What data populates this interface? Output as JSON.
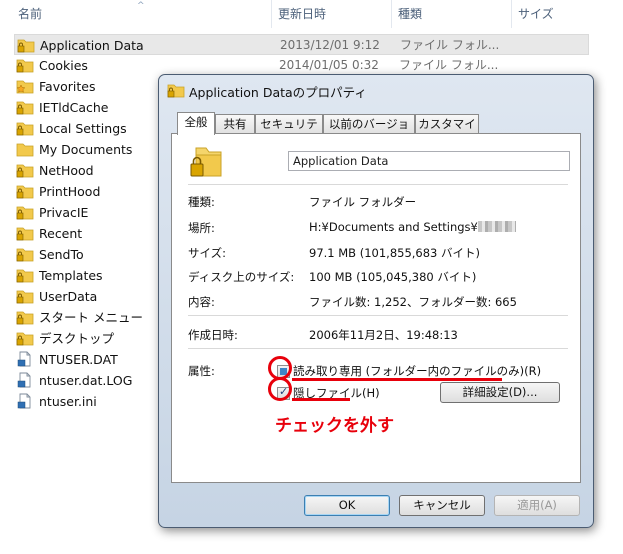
{
  "columns": {
    "name": "名前",
    "date": "更新日時",
    "type": "種類",
    "size": "サイズ"
  },
  "files": [
    {
      "name": "Application Data",
      "date": "2013/12/01 9:12",
      "type": "ファイル フォル...",
      "icon": "locked-folder-icon"
    },
    {
      "name": "Cookies",
      "date": "2014/01/05 0:32",
      "type": "ファイル フォル...",
      "icon": "locked-folder-icon"
    },
    {
      "name": "Favorites",
      "date": "",
      "type": "",
      "icon": "star-folder-icon"
    },
    {
      "name": "IETldCache",
      "date": "",
      "type": "",
      "icon": "locked-folder-icon"
    },
    {
      "name": "Local Settings",
      "date": "",
      "type": "",
      "icon": "locked-folder-icon"
    },
    {
      "name": "My Documents",
      "date": "",
      "type": "",
      "icon": "folder-icon"
    },
    {
      "name": "NetHood",
      "date": "",
      "type": "",
      "icon": "locked-folder-icon"
    },
    {
      "name": "PrintHood",
      "date": "",
      "type": "",
      "icon": "locked-folder-icon"
    },
    {
      "name": "PrivacIE",
      "date": "",
      "type": "",
      "icon": "locked-folder-icon"
    },
    {
      "name": "Recent",
      "date": "",
      "type": "",
      "icon": "locked-folder-icon"
    },
    {
      "name": "SendTo",
      "date": "",
      "type": "",
      "icon": "locked-folder-icon"
    },
    {
      "name": "Templates",
      "date": "",
      "type": "",
      "icon": "locked-folder-icon"
    },
    {
      "name": "UserData",
      "date": "",
      "type": "",
      "icon": "locked-folder-icon"
    },
    {
      "name": "スタート メニュー",
      "date": "",
      "type": "",
      "icon": "locked-folder-icon"
    },
    {
      "name": "デスクトップ",
      "date": "",
      "type": "",
      "icon": "locked-folder-icon"
    },
    {
      "name": "NTUSER.DAT",
      "date": "",
      "type": "",
      "icon": "file-icon"
    },
    {
      "name": "ntuser.dat.LOG",
      "date": "",
      "type": "",
      "icon": "file-icon"
    },
    {
      "name": "ntuser.ini",
      "date": "",
      "type": "",
      "icon": "file-icon"
    }
  ],
  "dialog": {
    "title": "Application Dataのプロパティ",
    "tabs": [
      "全般",
      "共有",
      "セキュリティ",
      "以前のバージョン",
      "カスタマイズ"
    ],
    "name_value": "Application Data",
    "labels": {
      "type": "種類:",
      "location": "場所:",
      "size": "サイズ:",
      "size_on_disk": "ディスク上のサイズ:",
      "contents": "内容:",
      "created": "作成日時:",
      "attributes": "属性:"
    },
    "values": {
      "type": "ファイル フォルダー",
      "location": "H:¥Documents and Settings¥",
      "size": "97.1 MB (101,855,683 バイト)",
      "size_on_disk": "100 MB (105,045,380 バイト)",
      "contents": "ファイル数: 1,252、フォルダー数: 665",
      "created": "2006年11月2日、19:48:13"
    },
    "readonly_label": "読み取り専用 (フォルダー内のファイルのみ)(R)",
    "hidden_label": "隠しファイル(H)",
    "advanced_button": "詳細設定(D)...",
    "ok_button": "OK",
    "cancel_button": "キャンセル",
    "apply_button": "適用(A)"
  },
  "annotation": "チェックを外す",
  "colors": {
    "annotation_red": "#e8000b",
    "folder_yellow": "#f2c94c"
  }
}
